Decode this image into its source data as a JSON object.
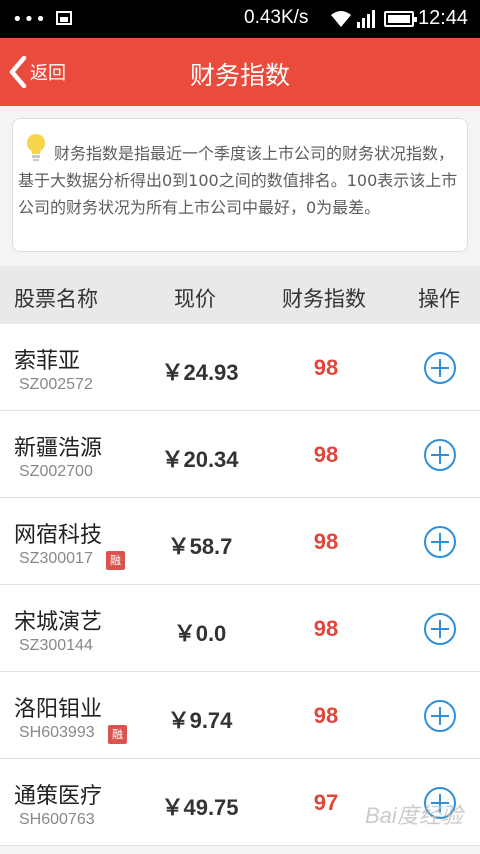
{
  "status_bar": {
    "dots": "•••",
    "net_speed": "0.43K/s",
    "time": "12:44"
  },
  "header": {
    "back_label": "返回",
    "title": "财务指数"
  },
  "info": {
    "text": "财务指数是指最近一个季度该上市公司的财务状况指数，基于大数据分析得出0到100之间的数值排名。100表示该上市公司的财务状况为所有上市公司中最好，0为最差。"
  },
  "table": {
    "columns": [
      "股票名称",
      "现价",
      "财务指数",
      "操作"
    ],
    "rows": [
      {
        "name": "索菲亚",
        "code": "SZ002572",
        "badge": "",
        "price": "￥24.93",
        "score": "98"
      },
      {
        "name": "新疆浩源",
        "code": "SZ002700",
        "badge": "",
        "price": "￥20.34",
        "score": "98"
      },
      {
        "name": "网宿科技",
        "code": "SZ300017",
        "badge": "融",
        "price": "￥58.7",
        "score": "98"
      },
      {
        "name": "宋城演艺",
        "code": "SZ300144",
        "badge": "",
        "price": "￥0.0",
        "score": "98"
      },
      {
        "name": "洛阳钼业",
        "code": "SH603993",
        "badge": "融",
        "price": "￥9.74",
        "score": "98"
      },
      {
        "name": "通策医疗",
        "code": "SH600763",
        "badge": "",
        "price": "￥49.75",
        "score": "97"
      }
    ]
  },
  "watermark": "Bai度经验",
  "colors": {
    "header": "#ea4b3c",
    "score": "#e0463a",
    "add_icon": "#2f8fd8",
    "badge": "#d9534f"
  },
  "icons": {
    "back": "chevron-left-icon",
    "bulb": "lightbulb-icon",
    "add": "plus-circle-icon"
  }
}
